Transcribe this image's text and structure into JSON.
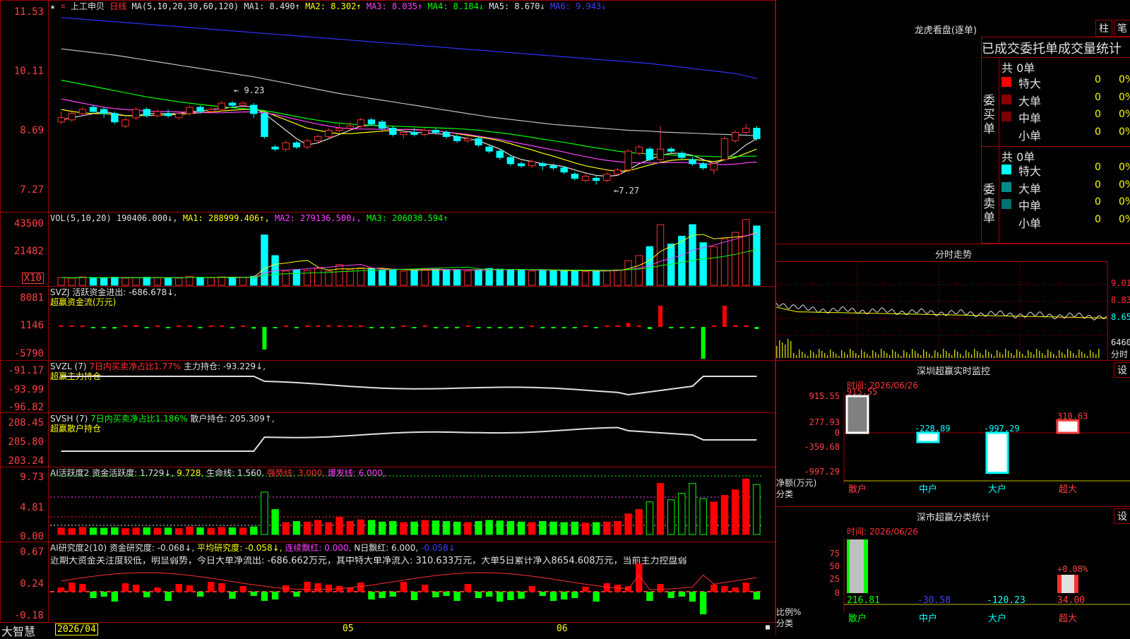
{
  "app": {
    "brand": "大智慧",
    "date_start": "2026/04",
    "month1": "05",
    "month2": "06"
  },
  "price_panel": {
    "stock": "上工申贝",
    "period": "日线",
    "legend": [
      "MA(5,10,20,30,60,120)",
      "MA1: 8.490↑",
      "MA2: 8.302↑",
      "MA3: 8.035↑",
      "MA4: 8.184↓",
      "MA5: 8.670↓",
      "MA6: 9.943↓"
    ],
    "ticks": [
      "11.53",
      "10.11",
      "8.69",
      "7.27"
    ],
    "high_label": "← 9.23",
    "low_label": "←7.27"
  },
  "vol_panel": {
    "legend": [
      "VOL(5,10,20)",
      "190406.000↓,",
      "MA1: 288999.406↑,",
      "MA2: 279136.500↓,",
      "MA3: 206038.594↑"
    ],
    "ticks": [
      "43500",
      "21482",
      "X10"
    ]
  },
  "svzj_panel": {
    "legend1": "SVZJ  活跃资金进出: -686.678↓,",
    "legend2": "超赢资金流(万元)",
    "ticks": [
      "8081",
      "1146",
      "-5790"
    ]
  },
  "svzl_panel": {
    "legend_a": "SVZL (7)",
    "legend_b": "7日内买卖净占比1.77%",
    "legend_c": "主力持仓: -93.229↓,",
    "legend2": "超赢主力持仓",
    "ticks": [
      "-91.17",
      "-93.99",
      "-96.82"
    ]
  },
  "svsh_panel": {
    "legend_a": "SVSH (7)",
    "legend_b": "7日内买卖净占比1.186%",
    "legend_c": "散户持仓: 205.309↑,",
    "legend2": "超赢散户持仓",
    "ticks": [
      "208.45",
      "205.80",
      "203.24"
    ]
  },
  "ai_active_panel": {
    "legend": [
      "AI活跃度2",
      "资金活跃度: 1.729↓,",
      "9.728,",
      "生命线: 1.560,",
      "强势线: 3.000,",
      "爆发线: 6.000,"
    ],
    "ticks": [
      "9.73",
      "4.81",
      "0.00"
    ]
  },
  "ai_research_panel": {
    "legend": [
      "AI研究度2(10)",
      "资金研究度: -0.068↓,",
      "平均研究度: -0.058↓,",
      "连续飘红: 0.000,",
      "N日飘红: 6.000,",
      "-0.058↓"
    ],
    "comment": "近期大资金关注度较低，明显弱势，今日大单净流出: -686.662万元，其中特大单净流入: 310.633万元，大单5日累计净入8654.608万元，当前主力控盘弱",
    "ticks": [
      "0.67",
      "0.24",
      "-0.18"
    ]
  },
  "dragon_panel": {
    "title": "龙虎看盘(逐单)",
    "btn_zhu": "柱",
    "btn_bi": "笔",
    "subtitle": "已成交委托单成交量统计",
    "buy_label": "委买单",
    "sell_label": "委卖单",
    "buy_total": "共 0单",
    "sell_total": "共 0单",
    "rows": [
      {
        "name": "特大",
        "count": "0",
        "pct": "0%"
      },
      {
        "name": "大单",
        "count": "0",
        "pct": "0%"
      },
      {
        "name": "中单",
        "count": "0",
        "pct": "0%"
      },
      {
        "name": "小单",
        "count": "0",
        "pct": "0%"
      }
    ],
    "buy_colors": [
      "#ff0000",
      "#8b0000",
      "#7a0000",
      "#000000"
    ],
    "sell_colors": [
      "#00ffff",
      "#008b8b",
      "#007070",
      "#000000"
    ]
  },
  "intraday_panel": {
    "title": "分时走势",
    "ticks": [
      "9.01",
      "8.83",
      "8.65",
      "6460"
    ],
    "vol_label": "分时"
  },
  "monitor_panel": {
    "title": "深圳超赢实时监控",
    "btn": "设",
    "date": "时间: 2026/06/26",
    "ticks": [
      "915.55",
      "277.93",
      "0",
      "-359.68",
      "-997.29"
    ],
    "unit": "净额(万元)",
    "class_label": "分类",
    "bars": [
      {
        "name": "散户",
        "value": 915.55,
        "label": "915.55"
      },
      {
        "name": "中户",
        "value": -228.89,
        "label": "-228.89"
      },
      {
        "name": "大户",
        "value": -997.29,
        "label": "-997.29"
      },
      {
        "name": "超大",
        "value": 310.63,
        "label": "310.63"
      }
    ]
  },
  "stats_panel": {
    "title": "深市超赢分类统计",
    "btn": "设",
    "date": "时间: 2026/06/26",
    "ticks": [
      "75",
      "50",
      "25",
      "0"
    ],
    "unit": "比例%",
    "class_label": "分类",
    "pct_label": "+0.08%",
    "bars": [
      {
        "name": "散户",
        "value": 216.81,
        "label": "216.81"
      },
      {
        "name": "中户",
        "value": -30.58,
        "label": "-30.58"
      },
      {
        "name": "大户",
        "value": -120.23,
        "label": "-120.23"
      },
      {
        "name": "超大",
        "value": 34.0,
        "label": "34.00"
      }
    ]
  },
  "chart_data": {
    "type": "candlestick",
    "title": "上工申贝 日线",
    "ylim": [
      7.0,
      11.7
    ],
    "candles": [
      [
        9.0,
        9.1,
        9.25,
        8.95
      ],
      [
        9.05,
        9.2,
        9.3,
        9.0
      ],
      [
        9.2,
        9.3,
        9.35,
        9.15
      ],
      [
        9.35,
        9.25,
        9.4,
        9.2
      ],
      [
        9.3,
        9.2,
        9.35,
        9.1
      ],
      [
        9.2,
        9.0,
        9.25,
        8.95
      ],
      [
        8.9,
        9.05,
        9.1,
        8.85
      ],
      [
        9.1,
        9.3,
        9.35,
        9.05
      ],
      [
        9.3,
        9.15,
        9.35,
        9.1
      ],
      [
        9.15,
        9.25,
        9.3,
        9.1
      ],
      [
        9.2,
        9.15,
        9.3,
        9.1
      ],
      [
        9.1,
        9.2,
        9.25,
        9.05
      ],
      [
        9.2,
        9.35,
        9.4,
        9.15
      ],
      [
        9.35,
        9.25,
        9.4,
        9.2
      ],
      [
        9.25,
        9.3,
        9.35,
        9.2
      ],
      [
        9.3,
        9.45,
        9.5,
        9.25
      ],
      [
        9.45,
        9.4,
        9.5,
        9.35
      ],
      [
        9.4,
        9.45,
        9.5,
        9.3
      ],
      [
        9.4,
        9.2,
        9.45,
        9.1
      ],
      [
        9.2,
        8.65,
        9.25,
        8.6
      ],
      [
        8.4,
        8.35,
        8.45,
        8.3
      ],
      [
        8.35,
        8.5,
        8.55,
        8.3
      ],
      [
        8.5,
        8.4,
        8.55,
        8.35
      ],
      [
        8.4,
        8.55,
        8.6,
        8.35
      ],
      [
        8.55,
        8.65,
        8.7,
        8.5
      ],
      [
        8.65,
        8.8,
        8.85,
        8.6
      ],
      [
        8.8,
        8.85,
        8.95,
        8.75
      ],
      [
        8.85,
        8.9,
        9.0,
        8.8
      ],
      [
        8.9,
        9.05,
        9.1,
        8.85
      ],
      [
        9.05,
        8.95,
        9.1,
        8.9
      ],
      [
        9.0,
        8.85,
        9.05,
        8.8
      ],
      [
        8.85,
        8.7,
        8.9,
        8.65
      ],
      [
        8.7,
        8.75,
        8.8,
        8.6
      ],
      [
        8.75,
        8.7,
        8.85,
        8.65
      ],
      [
        8.7,
        8.8,
        8.85,
        8.65
      ],
      [
        8.8,
        8.75,
        8.85,
        8.7
      ],
      [
        8.75,
        8.65,
        8.8,
        8.6
      ],
      [
        8.65,
        8.55,
        8.7,
        8.5
      ],
      [
        8.55,
        8.6,
        8.65,
        8.5
      ],
      [
        8.6,
        8.45,
        8.65,
        8.4
      ],
      [
        8.4,
        8.3,
        8.45,
        8.25
      ],
      [
        8.3,
        8.15,
        8.35,
        8.1
      ],
      [
        8.15,
        8.0,
        8.2,
        7.95
      ],
      [
        8.0,
        7.95,
        8.05,
        7.9
      ],
      [
        7.95,
        8.05,
        8.1,
        7.9
      ],
      [
        8.0,
        7.95,
        8.05,
        7.85
      ],
      [
        7.95,
        7.9,
        8.0,
        7.85
      ],
      [
        7.9,
        7.8,
        7.95,
        7.75
      ],
      [
        7.75,
        7.65,
        7.8,
        7.6
      ],
      [
        7.6,
        7.7,
        7.75,
        7.55
      ],
      [
        7.65,
        7.6,
        7.7,
        7.5
      ],
      [
        7.6,
        7.75,
        7.8,
        7.55
      ],
      [
        7.75,
        7.85,
        7.9,
        7.7
      ],
      [
        7.85,
        8.3,
        8.35,
        7.8
      ],
      [
        8.25,
        8.4,
        8.45,
        8.2
      ],
      [
        8.35,
        8.1,
        8.4,
        8.05
      ],
      [
        8.1,
        8.35,
        8.9,
        8.05
      ],
      [
        8.35,
        8.3,
        8.4,
        8.25
      ],
      [
        8.25,
        8.15,
        8.3,
        8.1
      ],
      [
        8.1,
        8.0,
        8.15,
        7.95
      ],
      [
        8.0,
        7.9,
        8.05,
        7.85
      ],
      [
        7.85,
        8.0,
        8.05,
        7.75
      ],
      [
        8.1,
        8.6,
        8.65,
        8.05
      ],
      [
        8.55,
        8.75,
        8.8,
        8.5
      ],
      [
        8.75,
        8.85,
        8.95,
        8.7
      ],
      [
        8.85,
        8.6,
        8.9,
        8.55
      ]
    ],
    "ma": [
      {
        "name": "MA1",
        "color": "#e0e0e0",
        "values": [
          9.05,
          9.1,
          9.15,
          9.2,
          9.25,
          9.2,
          9.15,
          9.15,
          9.2,
          9.2,
          9.2,
          9.2,
          9.25,
          9.25,
          9.3,
          9.32,
          9.35,
          9.38,
          9.35,
          9.2,
          9.0,
          8.8,
          8.6,
          8.45,
          8.5,
          8.6,
          8.7,
          8.8,
          8.9,
          8.92,
          8.9,
          8.82,
          8.78,
          8.75,
          8.74,
          8.72,
          8.7,
          8.65,
          8.6,
          8.55,
          8.45,
          8.35,
          8.2,
          8.1,
          8.05,
          8.0,
          7.97,
          7.93,
          7.85,
          7.78,
          7.72,
          7.7,
          7.72,
          7.85,
          8.0,
          8.1,
          8.2,
          8.25,
          8.25,
          8.2,
          8.1,
          8.0,
          8.1,
          8.25,
          8.45,
          8.6
        ]
      },
      {
        "name": "MA2",
        "color": "#ffff00",
        "values": [
          9.3,
          9.25,
          9.22,
          9.2,
          9.2,
          9.18,
          9.15,
          9.15,
          9.15,
          9.16,
          9.17,
          9.18,
          9.2,
          9.22,
          9.24,
          9.26,
          9.28,
          9.3,
          9.3,
          9.25,
          9.15,
          9.05,
          8.95,
          8.85,
          8.8,
          8.75,
          8.72,
          8.72,
          8.74,
          8.76,
          8.78,
          8.8,
          8.82,
          8.82,
          8.8,
          8.78,
          8.76,
          8.72,
          8.68,
          8.64,
          8.6,
          8.55,
          8.48,
          8.4,
          8.33,
          8.25,
          8.18,
          8.1,
          8.02,
          7.95,
          7.9,
          7.85,
          7.82,
          7.83,
          7.9,
          7.97,
          8.03,
          8.08,
          8.1,
          8.1,
          8.08,
          8.05,
          8.1,
          8.15,
          8.25,
          8.35
        ]
      },
      {
        "name": "MA3",
        "color": "#ff40ff",
        "values": [
          9.55,
          9.5,
          9.45,
          9.4,
          9.35,
          9.32,
          9.3,
          9.28,
          9.26,
          9.25,
          9.25,
          9.24,
          9.23,
          9.22,
          9.22,
          9.22,
          9.23,
          9.24,
          9.24,
          9.22,
          9.18,
          9.12,
          9.06,
          9.0,
          8.95,
          8.9,
          8.86,
          8.84,
          8.83,
          8.83,
          8.82,
          8.82,
          8.82,
          8.81,
          8.8,
          8.78,
          8.76,
          8.73,
          8.7,
          8.66,
          8.62,
          8.58,
          8.53,
          8.48,
          8.43,
          8.38,
          8.33,
          8.28,
          8.22,
          8.17,
          8.12,
          8.08,
          8.05,
          8.03,
          8.02,
          8.02,
          8.02,
          8.03,
          8.03,
          8.02,
          8.0,
          7.98,
          7.98,
          7.99,
          8.02,
          8.04
        ]
      },
      {
        "name": "MA4",
        "color": "#00ff00",
        "values": [
          10.0,
          9.95,
          9.9,
          9.85,
          9.8,
          9.75,
          9.7,
          9.65,
          9.6,
          9.56,
          9.52,
          9.48,
          9.45,
          9.42,
          9.39,
          9.36,
          9.34,
          9.32,
          9.3,
          9.27,
          9.23,
          9.18,
          9.13,
          9.08,
          9.04,
          9.0,
          8.97,
          8.95,
          8.93,
          8.92,
          8.91,
          8.9,
          8.89,
          8.88,
          8.87,
          8.86,
          8.85,
          8.84,
          8.82,
          8.8,
          8.77,
          8.74,
          8.71,
          8.67,
          8.63,
          8.59,
          8.55,
          8.51,
          8.47,
          8.42,
          8.38,
          8.34,
          8.3,
          8.27,
          8.25,
          8.23,
          8.22,
          8.21,
          8.2,
          8.19,
          8.18,
          8.17,
          8.17,
          8.17,
          8.18,
          8.18
        ]
      },
      {
        "name": "MA5",
        "color": "#c0c0c0",
        "values": [
          10.75,
          10.72,
          10.69,
          10.66,
          10.63,
          10.6,
          10.56,
          10.52,
          10.48,
          10.44,
          10.4,
          10.36,
          10.32,
          10.28,
          10.24,
          10.2,
          10.16,
          10.12,
          10.08,
          10.03,
          9.98,
          9.93,
          9.88,
          9.83,
          9.78,
          9.73,
          9.68,
          9.64,
          9.6,
          9.56,
          9.52,
          9.48,
          9.44,
          9.4,
          9.36,
          9.32,
          9.28,
          9.24,
          9.2,
          9.16,
          9.12,
          9.09,
          9.06,
          9.03,
          9.0,
          8.97,
          8.94,
          8.92,
          8.9,
          8.88,
          8.86,
          8.84,
          8.82,
          8.8,
          8.79,
          8.78,
          8.76,
          8.75,
          8.74,
          8.73,
          8.72,
          8.71,
          8.7,
          8.69,
          8.68,
          8.67
        ]
      },
      {
        "name": "MA6",
        "color": "#3030ff",
        "values": [
          11.5,
          11.48,
          11.46,
          11.44,
          11.42,
          11.4,
          11.38,
          11.36,
          11.34,
          11.32,
          11.3,
          11.28,
          11.26,
          11.24,
          11.22,
          11.2,
          11.18,
          11.16,
          11.14,
          11.12,
          11.1,
          11.08,
          11.06,
          11.04,
          11.02,
          11.0,
          10.98,
          10.96,
          10.94,
          10.92,
          10.9,
          10.88,
          10.86,
          10.84,
          10.82,
          10.8,
          10.78,
          10.76,
          10.74,
          10.72,
          10.7,
          10.68,
          10.66,
          10.64,
          10.62,
          10.6,
          10.58,
          10.56,
          10.54,
          10.52,
          10.5,
          10.48,
          10.46,
          10.44,
          10.42,
          10.4,
          10.37,
          10.34,
          10.31,
          10.28,
          10.25,
          10.22,
          10.19,
          10.16,
          10.1,
          10.04
        ]
      }
    ],
    "volume": [
      60,
      55,
      65,
      60,
      58,
      62,
      55,
      60,
      62,
      58,
      60,
      55,
      70,
      62,
      58,
      65,
      62,
      60,
      70,
      390,
      230,
      110,
      120,
      115,
      130,
      110,
      160,
      120,
      135,
      130,
      115,
      120,
      110,
      115,
      130,
      125,
      120,
      115,
      110,
      120,
      130,
      125,
      120,
      115,
      110,
      120,
      115,
      110,
      115,
      105,
      110,
      115,
      120,
      190,
      230,
      300,
      470,
      320,
      380,
      470,
      330,
      300,
      360,
      410,
      510,
      460
    ]
  }
}
